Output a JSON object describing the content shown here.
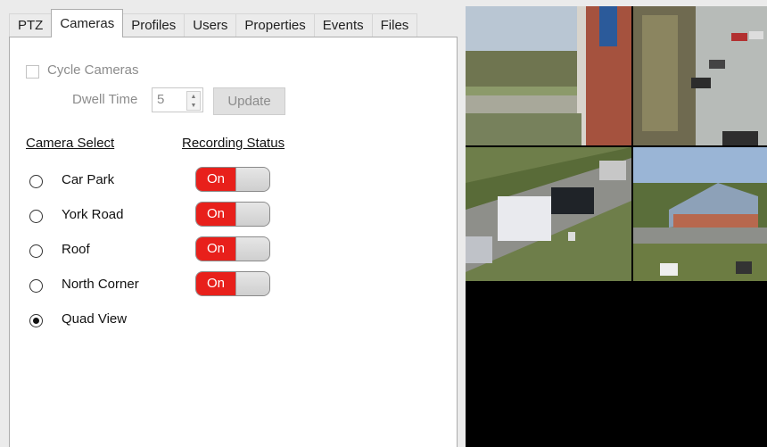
{
  "tabs": [
    "PTZ",
    "Cameras",
    "Profiles",
    "Users",
    "Properties",
    "Events",
    "Files"
  ],
  "active_tab": "Cameras",
  "cycle_cameras": {
    "label": "Cycle Cameras",
    "checked": false
  },
  "dwell": {
    "label": "Dwell Time",
    "value": "5"
  },
  "update_button": "Update",
  "headers": {
    "camera_select": "Camera Select",
    "recording_status": "Recording Status"
  },
  "cameras": [
    {
      "name": "Car Park",
      "selected": false,
      "recording": "On"
    },
    {
      "name": "York Road",
      "selected": false,
      "recording": "On"
    },
    {
      "name": "Roof",
      "selected": false,
      "recording": "On"
    },
    {
      "name": "North Corner",
      "selected": false,
      "recording": "On"
    },
    {
      "name": "Quad View",
      "selected": true,
      "recording": null
    }
  ],
  "colors": {
    "toggle_on": "#e8201b",
    "video_bg": "#000000"
  }
}
